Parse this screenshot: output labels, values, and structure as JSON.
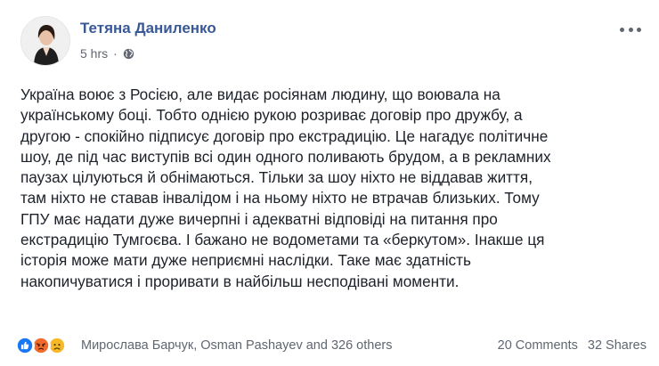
{
  "post": {
    "author": "Тетяна Даниленко",
    "time": "5 hrs",
    "privacy_icon": "globe-icon",
    "text": "Україна воює з Росією, але видає росіянам людину, що воювала на\nукраїнському боці. Тобто однією рукою розриває договір про дружбу, а\nдругою - спокійно підписує договір про екстрадицію. Це нагадує політичне\nшоу, де під час виступів всі один одного поливають брудом, а в рекламних\nпаузах цілуються й обнімаються. Тільки за шоу ніхто не віддавав життя,\nтам ніхто не ставав інвалідом і на ньому ніхто не втрачав близьких. Тому\nГПУ має надати дуже вичерпні і адекватні відповіді на питання про\nекстрадицію Тумгоєва. І бажано не водометами та «беркутом». Інакше ця\nісторія може мати дуже неприємні наслідки. Таке має здатність\nнакопичуватися і проривати в найбільш несподівані моменти."
  },
  "reactions": {
    "icons": [
      "like-icon",
      "angry-icon",
      "sad-icon"
    ],
    "names": "Мирослава Барчук, Osman Pashayev and 326 others",
    "comments": "20 Comments",
    "shares": "32 Shares"
  },
  "colors": {
    "author": "#385898",
    "meta": "#616770",
    "like": "#1877f2",
    "angry": "#f26a2c",
    "sad": "#f7b928"
  }
}
